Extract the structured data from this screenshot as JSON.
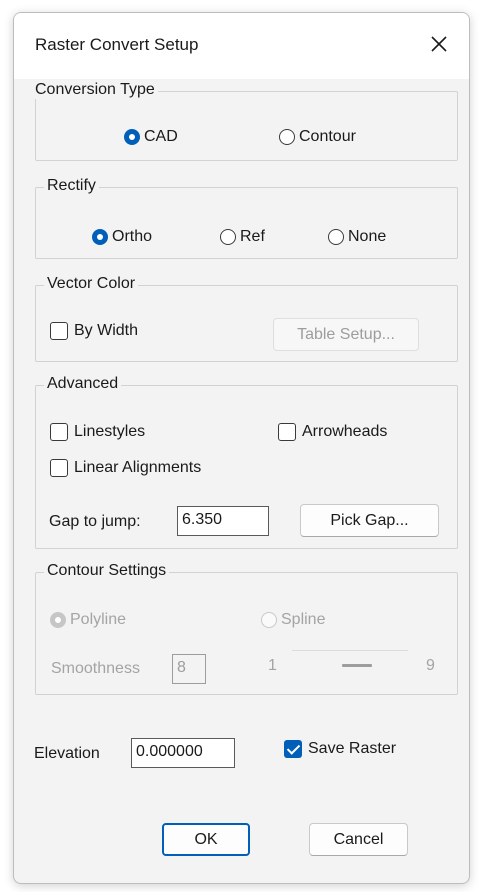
{
  "dialog": {
    "title": "Raster Convert Setup"
  },
  "conversion_type": {
    "legend": "Conversion Type",
    "options": [
      {
        "label": "CAD",
        "selected": true
      },
      {
        "label": "Contour",
        "selected": false
      }
    ]
  },
  "rectify": {
    "legend": "Rectify",
    "options": [
      {
        "label": "Ortho",
        "selected": true
      },
      {
        "label": "Ref",
        "selected": false
      },
      {
        "label": "None",
        "selected": false
      }
    ]
  },
  "vector_color": {
    "legend": "Vector Color",
    "by_width": {
      "label": "By Width",
      "checked": false
    },
    "table_setup_label": "Table Setup..."
  },
  "advanced": {
    "legend": "Advanced",
    "linestyles": {
      "label": "Linestyles",
      "checked": false
    },
    "arrowheads": {
      "label": "Arrowheads",
      "checked": false
    },
    "linear_alignments": {
      "label": "Linear Alignments",
      "checked": false
    },
    "gap_label": "Gap to jump:",
    "gap_value": "6.350",
    "pick_gap_label": "Pick Gap..."
  },
  "contour_settings": {
    "legend": "Contour Settings",
    "options": [
      {
        "label": "Polyline",
        "selected": true
      },
      {
        "label": "Spline",
        "selected": false
      }
    ],
    "smoothness_label": "Smoothness",
    "smoothness_value": "8",
    "slider_min": "1",
    "slider_max": "9"
  },
  "elevation": {
    "label": "Elevation",
    "value": "0.000000"
  },
  "save_raster": {
    "label": "Save Raster",
    "checked": true
  },
  "buttons": {
    "ok": "OK",
    "cancel": "Cancel"
  },
  "colors": {
    "accent": "#005fb8",
    "dialog_bg": "#f3f3f3",
    "disabled_text": "#a4a4a4"
  }
}
